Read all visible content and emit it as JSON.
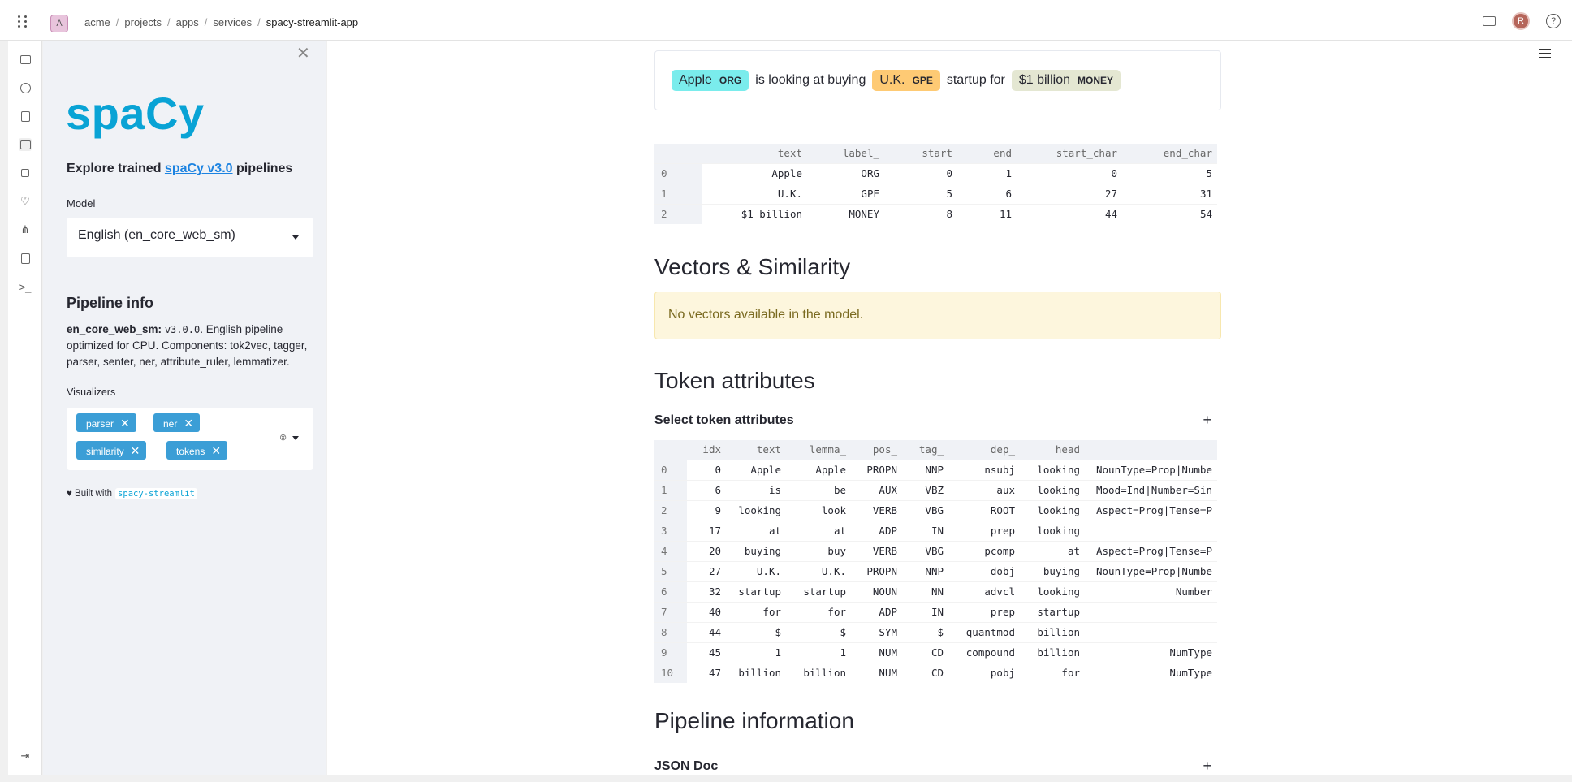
{
  "topbar": {
    "org_initial": "A",
    "breadcrumbs": [
      "acme",
      "projects",
      "apps",
      "services",
      "spacy-streamlit-app"
    ],
    "avatar_initial": "R",
    "help": "?"
  },
  "sidebar": {
    "close": "✕",
    "logo": "spaCy",
    "subtitle_pre": "Explore trained ",
    "subtitle_link": "spaCy v3.0",
    "subtitle_post": " pipelines",
    "model_label": "Model",
    "model_value": "English (en_core_web_sm)",
    "pipeline_title": "Pipeline info",
    "pipeline_name": "en_core_web_sm:",
    "pipeline_version": "v3.0.0",
    "pipeline_desc": ". English pipeline optimized for CPU. Components: tok2vec, tagger, parser, senter, ner, attribute_ruler, lemmatizer.",
    "visualizers_label": "Visualizers",
    "visualizers": [
      "parser",
      "ner",
      "similarity",
      "tokens"
    ],
    "built_with": "♥ Built with",
    "built_with_link": "spacy-streamlit"
  },
  "main": {
    "entities": {
      "t1": "Apple",
      "l1": "ORG",
      "s1": "is looking at buying",
      "t2": "U.K.",
      "l2": "GPE",
      "s2": "startup for",
      "t3": "$1 billion",
      "l3": "MONEY"
    },
    "ent_table": {
      "headers": [
        "text",
        "label_",
        "start",
        "end",
        "start_char",
        "end_char"
      ],
      "rows": [
        [
          "0",
          "Apple",
          "ORG",
          "0",
          "1",
          "0",
          "5"
        ],
        [
          "1",
          "U.K.",
          "GPE",
          "5",
          "6",
          "27",
          "31"
        ],
        [
          "2",
          "$1 billion",
          "MONEY",
          "8",
          "11",
          "44",
          "54"
        ]
      ]
    },
    "vectors_title": "Vectors & Similarity",
    "vectors_warning": "No vectors available in the model.",
    "tokens_title": "Token attributes",
    "tokens_expander": "Select token attributes",
    "token_table": {
      "headers": [
        "idx",
        "text",
        "lemma_",
        "pos_",
        "tag_",
        "dep_",
        "head",
        ""
      ],
      "rows": [
        [
          "0",
          "0",
          "Apple",
          "Apple",
          "PROPN",
          "NNP",
          "nsubj",
          "looking",
          "NounType=Prop|Numbe"
        ],
        [
          "1",
          "6",
          "is",
          "be",
          "AUX",
          "VBZ",
          "aux",
          "looking",
          "Mood=Ind|Number=Sin"
        ],
        [
          "2",
          "9",
          "looking",
          "look",
          "VERB",
          "VBG",
          "ROOT",
          "looking",
          "Aspect=Prog|Tense=P"
        ],
        [
          "3",
          "17",
          "at",
          "at",
          "ADP",
          "IN",
          "prep",
          "looking",
          ""
        ],
        [
          "4",
          "20",
          "buying",
          "buy",
          "VERB",
          "VBG",
          "pcomp",
          "at",
          "Aspect=Prog|Tense=P"
        ],
        [
          "5",
          "27",
          "U.K.",
          "U.K.",
          "PROPN",
          "NNP",
          "dobj",
          "buying",
          "NounType=Prop|Numbe"
        ],
        [
          "6",
          "32",
          "startup",
          "startup",
          "NOUN",
          "NN",
          "advcl",
          "looking",
          "Number"
        ],
        [
          "7",
          "40",
          "for",
          "for",
          "ADP",
          "IN",
          "prep",
          "startup",
          ""
        ],
        [
          "8",
          "44",
          "$",
          "$",
          "SYM",
          "$",
          "quantmod",
          "billion",
          ""
        ],
        [
          "9",
          "45",
          "1",
          "1",
          "NUM",
          "CD",
          "compound",
          "billion",
          "NumType"
        ],
        [
          "10",
          "47",
          "billion",
          "billion",
          "NUM",
          "CD",
          "pobj",
          "for",
          "NumType"
        ]
      ]
    },
    "pipeline_title": "Pipeline information",
    "json_expander": "JSON Doc",
    "plus": "+"
  }
}
